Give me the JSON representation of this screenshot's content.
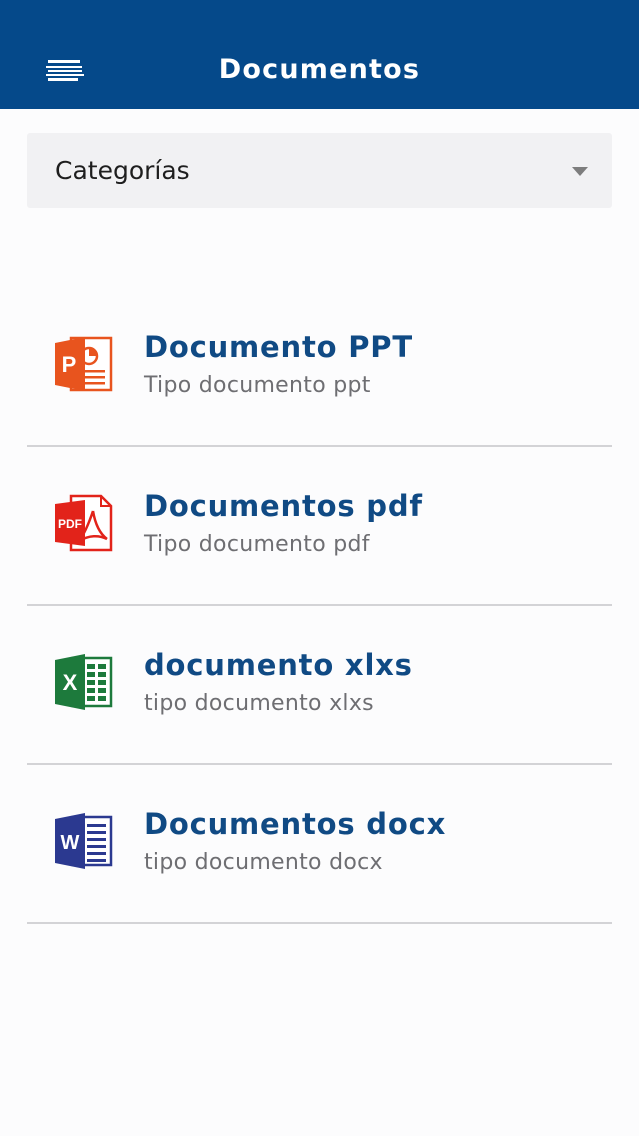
{
  "header": {
    "title": "Documentos",
    "menu_icon": "hamburger-menu-icon",
    "background": "#05498a"
  },
  "filter": {
    "label": "Categorías",
    "arrow_icon": "caret-down-icon"
  },
  "documents": [
    {
      "title": "Documento PPT",
      "subtitle": "Tipo documento ppt",
      "icon": "powerpoint-icon",
      "color": "#e8541e"
    },
    {
      "title": "Documentos pdf",
      "subtitle": "Tipo documento pdf",
      "icon": "pdf-icon",
      "color": "#e2231a"
    },
    {
      "title": "documento xlxs",
      "subtitle": "tipo documento xlxs",
      "icon": "excel-icon",
      "color": "#1d7a3c"
    },
    {
      "title": "Documentos docx",
      "subtitle": "tipo documento docx",
      "icon": "word-icon",
      "color": "#2b3990"
    }
  ],
  "colors": {
    "accent": "#104a84",
    "subtitle": "#6e6e72",
    "divider": "#d3d3d6"
  }
}
